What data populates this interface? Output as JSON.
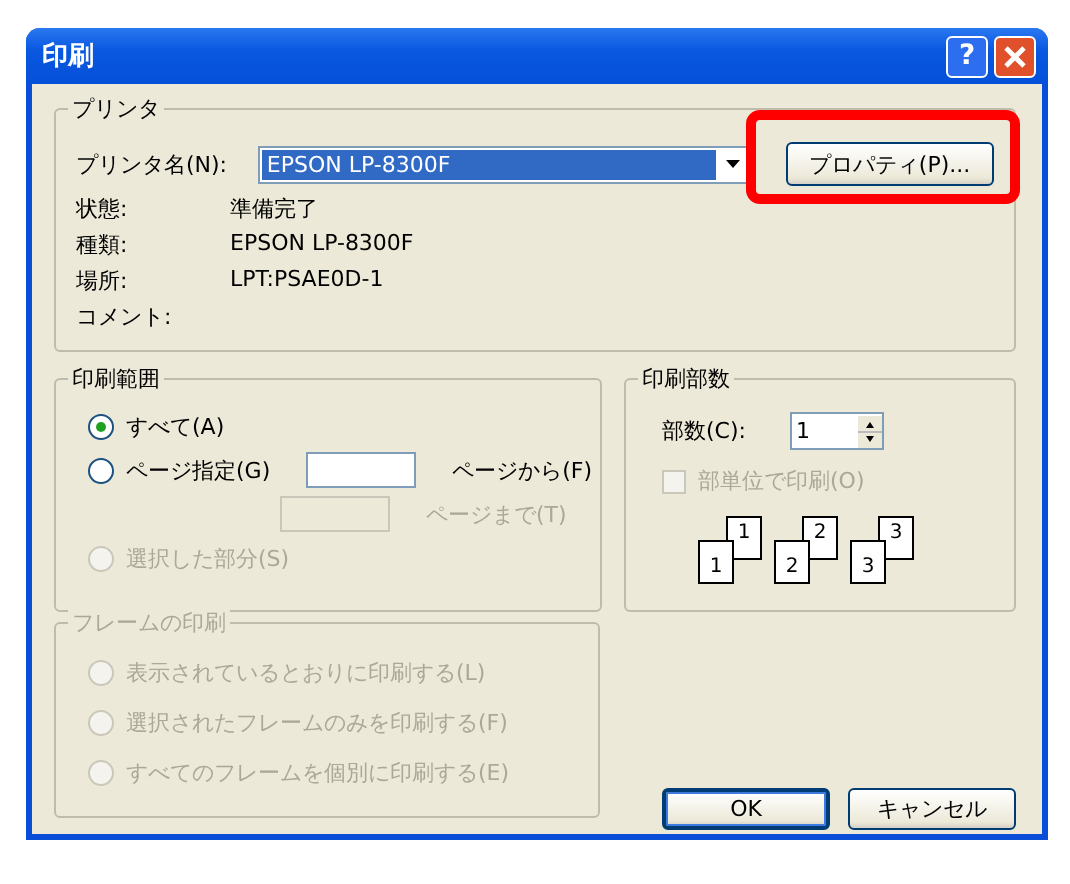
{
  "window": {
    "title": "印刷",
    "help_button": "?"
  },
  "printer": {
    "group_label": "プリンタ",
    "name_label": "プリンタ名(N):",
    "selected_printer": "EPSON LP-8300F",
    "properties_button": "プロパティ(P)...",
    "info": [
      {
        "label": "状態:",
        "value": "準備完了"
      },
      {
        "label": "種類:",
        "value": "EPSON LP-8300F"
      },
      {
        "label": "場所:",
        "value": "LPT:PSAE0D-1"
      },
      {
        "label": "コメント:"
      }
    ]
  },
  "print_range": {
    "group_label": "印刷範囲",
    "options": [
      {
        "label": "すべて(A)",
        "selected": true,
        "disabled": false
      },
      {
        "label": "ページ指定(G)",
        "selected": false,
        "disabled": false
      },
      {
        "label": "選択した部分(S)",
        "selected": false,
        "disabled": true
      }
    ],
    "from_label": "ページから(F)",
    "from_disabled": false,
    "to_label": "ページまで(T)",
    "to_disabled": true
  },
  "copies": {
    "group_label": "印刷部数",
    "copies_label": "部数(C):",
    "copies_value": "1",
    "collate": {
      "label": "部単位で印刷(O)",
      "checked": false,
      "disabled": true
    },
    "collate_pages": [
      {
        "back": "1",
        "front": "1"
      },
      {
        "back": "2",
        "front": "2"
      },
      {
        "back": "3",
        "front": "3"
      }
    ]
  },
  "frames": {
    "group_label": "フレームの印刷",
    "disabled": true,
    "options": [
      {
        "label": "表示されているとおりに印刷する(L)",
        "selected": false
      },
      {
        "label": "選択されたフレームのみを印刷する(F)",
        "selected": false
      },
      {
        "label": "すべてのフレームを個別に印刷する(E)",
        "selected": false
      }
    ]
  },
  "buttons": [
    {
      "label": "OK",
      "default": true
    },
    {
      "label": "キャンセル",
      "default": false
    }
  ],
  "annotation": {
    "kind": "highlight"
  }
}
